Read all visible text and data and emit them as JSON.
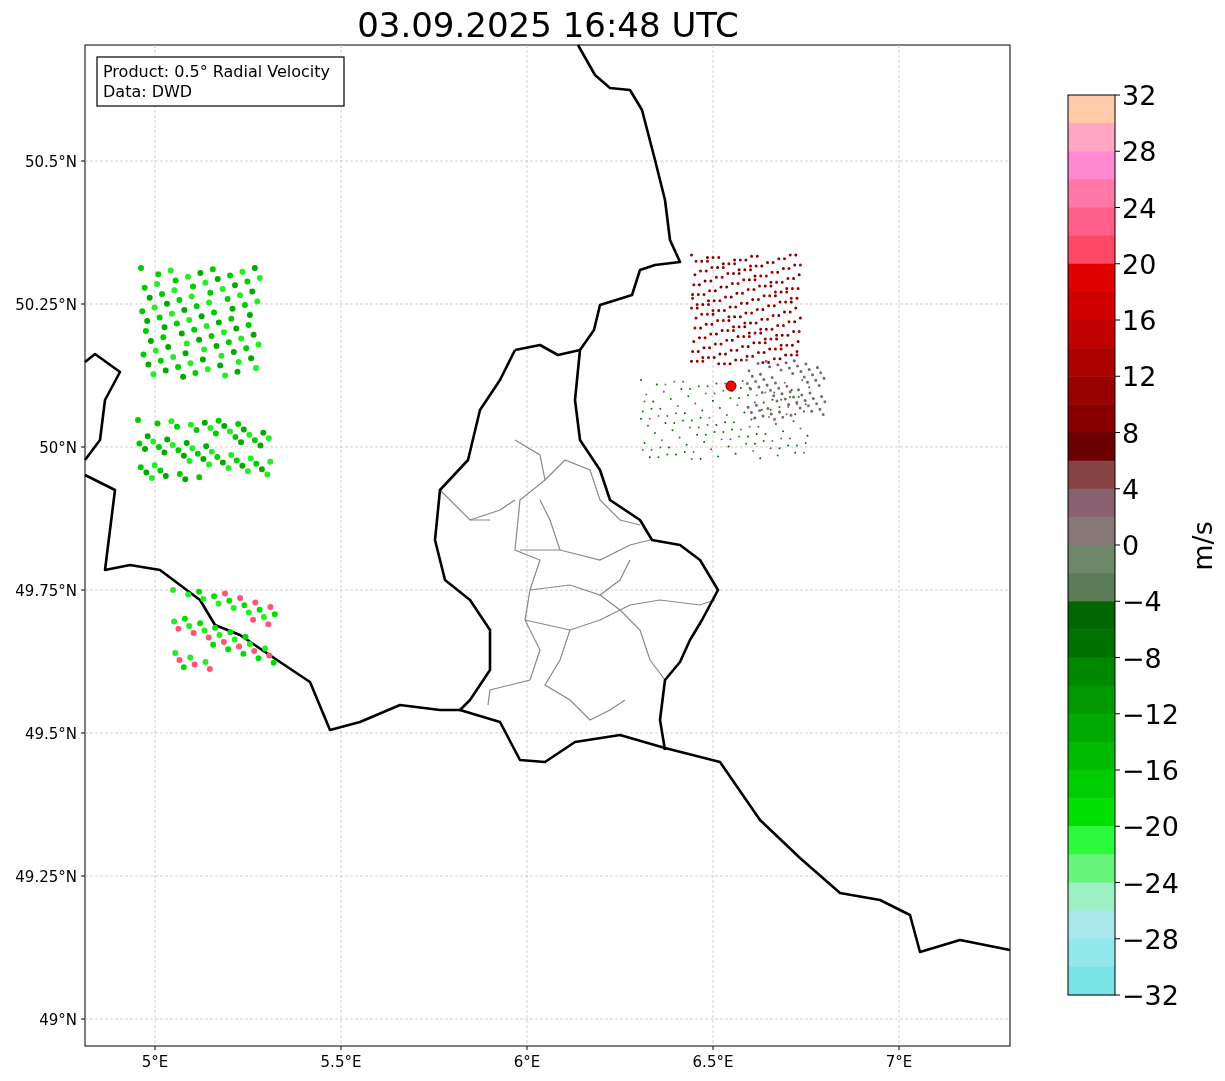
{
  "title": "03.09.2025 16:48 UTC",
  "legend": [
    "Product: 0.5° Radial Velocity",
    "Data: DWD"
  ],
  "map": {
    "xticks": [
      "5°E",
      "5.5°E",
      "6°E",
      "6.5°E",
      "7°E"
    ],
    "yticks": [
      "50.5°N",
      "50.25°N",
      "50°N",
      "49.75°N",
      "49.5°N",
      "49.25°N",
      "49°N"
    ]
  },
  "colorbar": {
    "label": "m/s",
    "ticks": [
      "32",
      "28",
      "24",
      "20",
      "16",
      "12",
      "8",
      "4",
      "0",
      "−4",
      "−8",
      "−12",
      "−16",
      "−20",
      "−24",
      "−28",
      "−32"
    ]
  }
}
